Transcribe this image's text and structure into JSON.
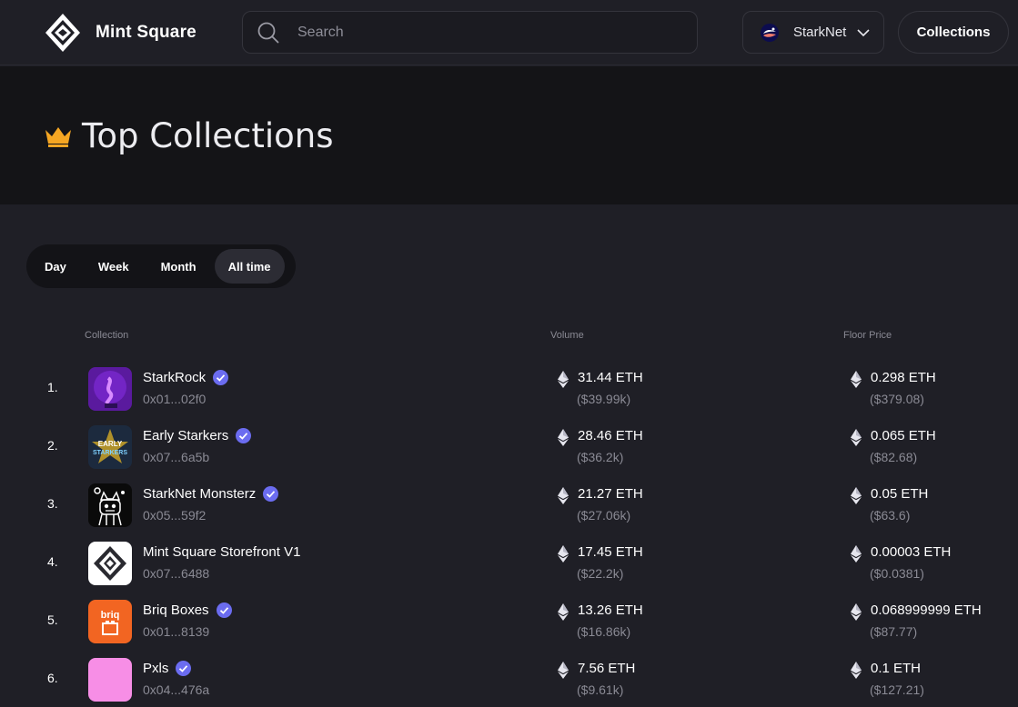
{
  "nav": {
    "brand": "Mint Square",
    "search_placeholder": "Search",
    "network": "StarkNet",
    "collections_button": "Collections"
  },
  "hero": {
    "title": "Top Collections",
    "icon": "crown-icon"
  },
  "periods": [
    "Day",
    "Week",
    "Month",
    "All time"
  ],
  "active_period": "All time",
  "table": {
    "headers": {
      "collection": "Collection",
      "volume": "Volume",
      "floor_price": "Floor Price"
    },
    "rows": [
      {
        "rank": "1.",
        "name": "StarkRock",
        "verified": true,
        "address": "0x01...02f0",
        "volume_eth": "31.44 ETH",
        "volume_usd": "($39.99k)",
        "floor_eth": "0.298 ETH",
        "floor_usd": "($379.08)"
      },
      {
        "rank": "2.",
        "name": "Early Starkers",
        "verified": true,
        "address": "0x07...6a5b",
        "volume_eth": "28.46 ETH",
        "volume_usd": "($36.2k)",
        "floor_eth": "0.065 ETH",
        "floor_usd": "($82.68)"
      },
      {
        "rank": "3.",
        "name": "StarkNet Monsterz",
        "verified": true,
        "address": "0x05...59f2",
        "volume_eth": "21.27 ETH",
        "volume_usd": "($27.06k)",
        "floor_eth": "0.05 ETH",
        "floor_usd": "($63.6)"
      },
      {
        "rank": "4.",
        "name": "Mint Square Storefront V1",
        "verified": false,
        "address": "0x07...6488",
        "volume_eth": "17.45 ETH",
        "volume_usd": "($22.2k)",
        "floor_eth": "0.00003 ETH",
        "floor_usd": "($0.0381)"
      },
      {
        "rank": "5.",
        "name": "Briq Boxes",
        "verified": true,
        "address": "0x01...8139",
        "volume_eth": "13.26 ETH",
        "volume_usd": "($16.86k)",
        "floor_eth": "0.068999999 ETH",
        "floor_usd": "($87.77)"
      },
      {
        "rank": "6.",
        "name": "Pxls",
        "verified": true,
        "address": "0x04...476a",
        "volume_eth": "7.56 ETH",
        "volume_usd": "($9.61k)",
        "floor_eth": "0.1 ETH",
        "floor_usd": "($127.21)"
      }
    ]
  },
  "thumb_labels": {
    "early_starkers_line1": "EARLY",
    "early_starkers_line2": "STARKERS",
    "briq": "briq"
  },
  "colors": {
    "background": "#1f1f26",
    "hero_background": "#141417",
    "verified": "#6b6cf0",
    "crown": "#f5a623",
    "muted_text": "#8a8a94"
  }
}
